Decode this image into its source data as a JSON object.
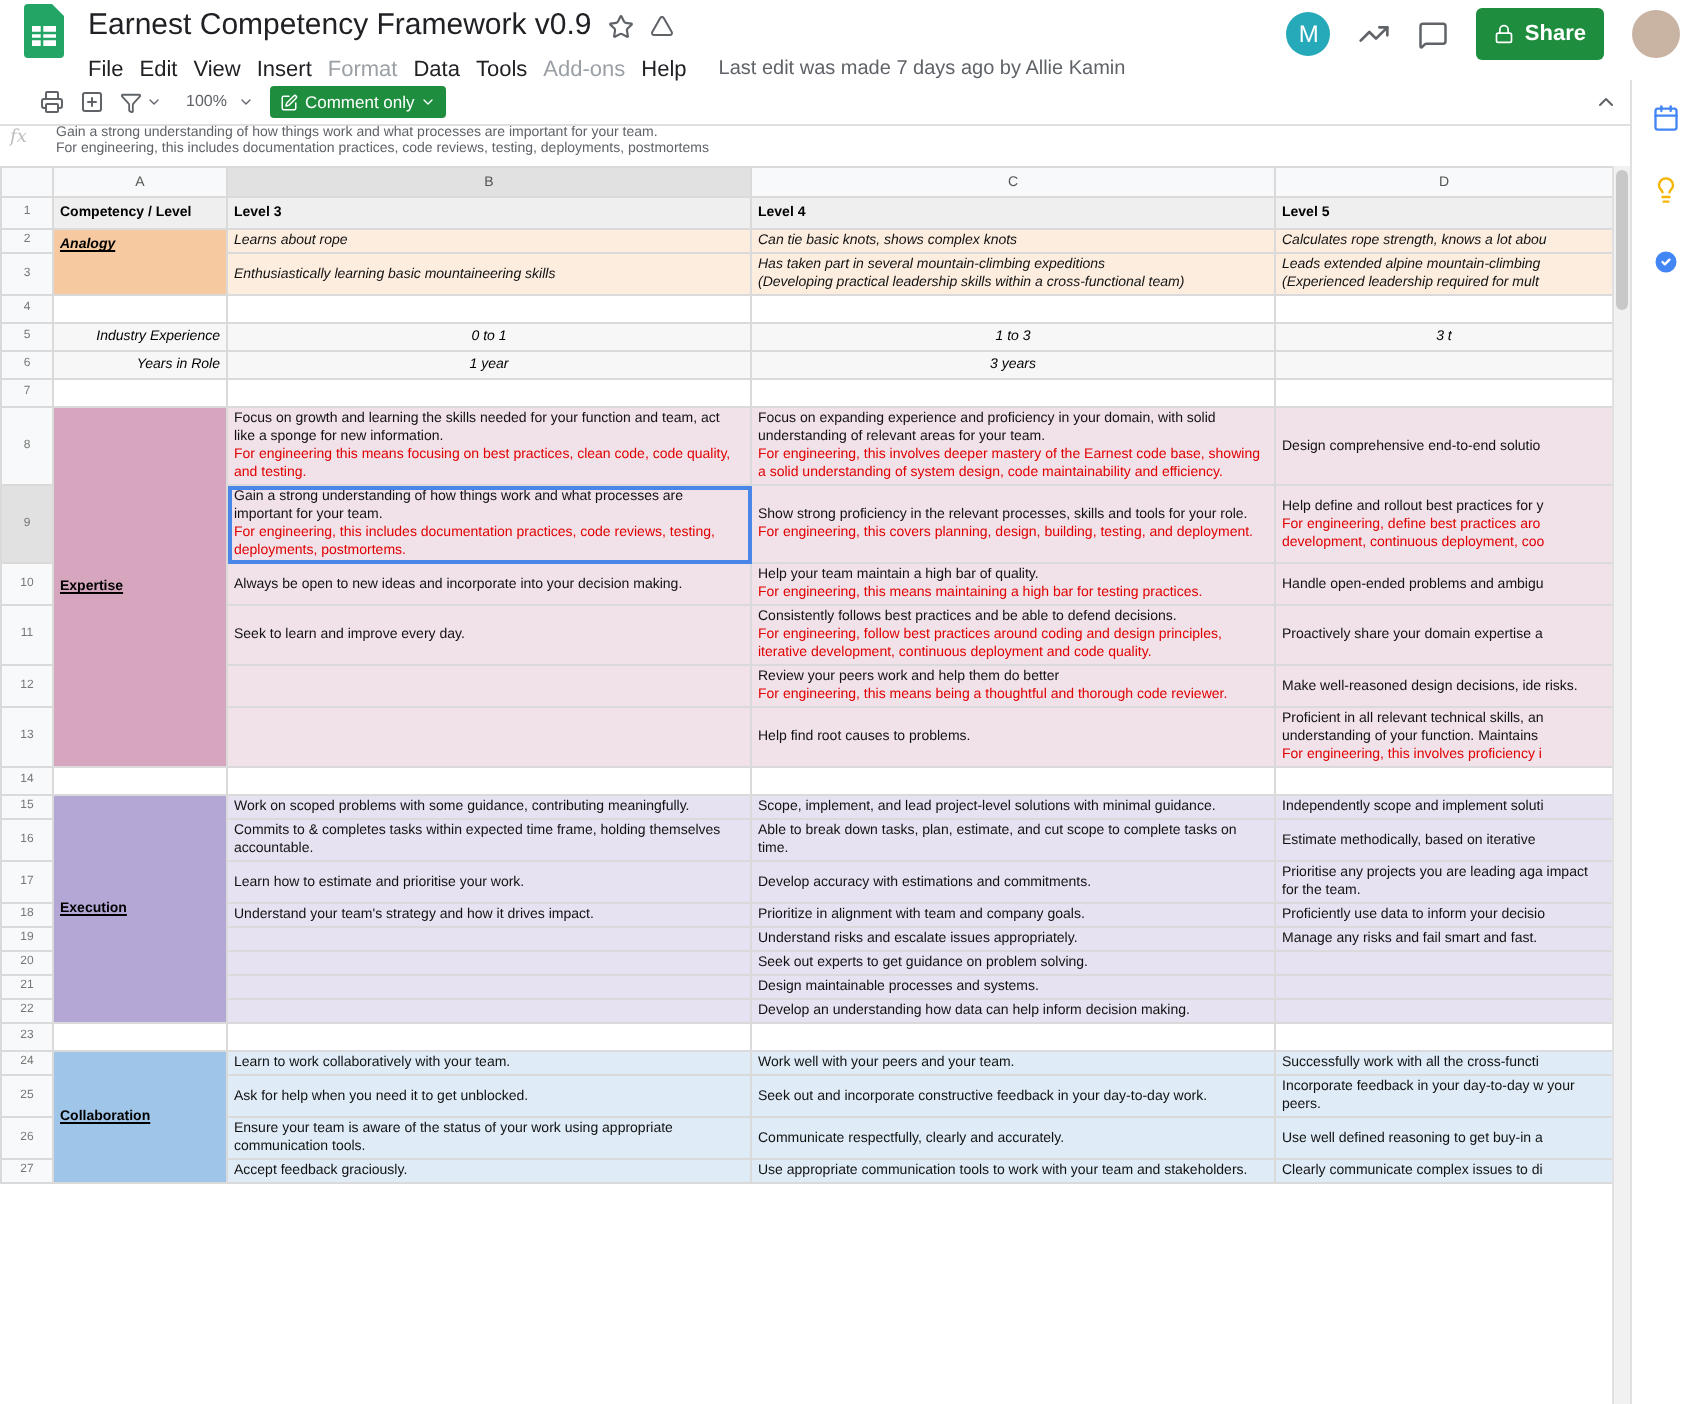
{
  "document": {
    "title": "Earnest Competency Framework v0.9",
    "starred": false,
    "last_edit": "Last edit was made 7 days ago by Allie Kamin"
  },
  "menu": [
    {
      "label": "File",
      "disabled": false
    },
    {
      "label": "Edit",
      "disabled": false
    },
    {
      "label": "View",
      "disabled": false
    },
    {
      "label": "Insert",
      "disabled": false
    },
    {
      "label": "Format",
      "disabled": true
    },
    {
      "label": "Data",
      "disabled": false
    },
    {
      "label": "Tools",
      "disabled": false
    },
    {
      "label": "Add-ons",
      "disabled": true
    },
    {
      "label": "Help",
      "disabled": false
    }
  ],
  "account": {
    "initial": "M"
  },
  "share": {
    "label": "Share"
  },
  "toolbar": {
    "zoom": "100%",
    "mode": "Comment only"
  },
  "formula_bar": {
    "label": "fx",
    "value": "Gain a strong understanding of how things work and what processes are important for your team.\nFor engineering, this includes documentation practices, code reviews, testing, deployments, postmortems"
  },
  "grid": {
    "columns": [
      {
        "label": "A",
        "selected": false
      },
      {
        "label": "B",
        "selected": true
      },
      {
        "label": "C",
        "selected": false
      },
      {
        "label": "D",
        "selected": false
      }
    ],
    "blocks": [
      {
        "kind": "header",
        "rows": [
          {
            "number": "1",
            "selected": false,
            "cells": [
              "Competency / Level",
              "Level 3",
              "Level 4",
              "Level 5"
            ]
          }
        ]
      },
      {
        "kind": "example",
        "label": "Analogy",
        "color": "#f6c9a0",
        "rows": [
          {
            "number": "2",
            "selected": false,
            "cells": [
              {
                "text": "Learns about rope"
              },
              {
                "text": "Can tie basic knots, shows complex knots"
              },
              {
                "text": "Calculates rope strength, knows a lot abou"
              }
            ]
          },
          {
            "number": "3",
            "selected": false,
            "cells": [
              {
                "text": "Enthusiastically learning basic mountaineering skills"
              },
              {
                "text": "Has taken part in several mountain-climbing expeditions\n(Developing practical leadership skills within a cross-functional team)"
              },
              {
                "text": "Leads extended alpine mountain-climbing\n(Experienced leadership required for mult"
              }
            ]
          }
        ]
      },
      {
        "kind": "spacer",
        "rows": [
          {
            "number": "4",
            "selected": false
          }
        ]
      },
      {
        "kind": "attribute",
        "rows": [
          {
            "number": "5",
            "selected": false,
            "label": "Industry Experience",
            "cells": [
              "0 to 1",
              "1 to 3",
              "3 t"
            ]
          },
          {
            "number": "6",
            "selected": false,
            "label": "Years in Role",
            "cells": [
              "1 year",
              "3 years"
            ]
          }
        ]
      },
      {
        "kind": "spacer",
        "rows": [
          {
            "number": "7",
            "selected": false
          }
        ]
      },
      {
        "kind": "competency",
        "label": "Expertise",
        "color": "#d5a6bd",
        "rows": [
          {
            "number": "8",
            "selected": false,
            "cells": [
              {
                "text": "Focus on growth and learning the skills needed for your function and team, act like a sponge for new information.",
                "note": "For engineering this means focusing on best practices, clean code, code quality, and testing."
              },
              {
                "text": "Focus on expanding experience and proficiency in your domain, with solid understanding of relevant areas for your team.",
                "note": "For engineering, this involves deeper mastery of the Earnest code base, showing a solid understanding of system design, code maintainability and efficiency."
              },
              {
                "text": "Design comprehensive end-to-end solutio"
              }
            ]
          },
          {
            "number": "9",
            "selected": true,
            "cells": [
              {
                "text": "Gain a strong understanding of how things work and what processes are important for your team.",
                "note": "For engineering, this includes documentation practices, code reviews, testing, deployments, postmortems."
              },
              {
                "text": "Show strong proficiency in the relevant processes, skills and tools for your role.",
                "note": "For engineering, this covers planning, design, building, testing, and deployment."
              },
              {
                "text": "Help define and rollout best practices for y",
                "note": "For engineering, define best practices aro development, continuous deployment, coo"
              }
            ]
          },
          {
            "number": "10",
            "selected": false,
            "cells": [
              {
                "text": "Always be open to new ideas and incorporate into your decision making."
              },
              {
                "text": "Help your team maintain a high bar of quality.",
                "note": "For engineering, this means maintaining a high bar for testing practices."
              },
              {
                "text": "Handle open-ended problems and ambigu"
              }
            ]
          },
          {
            "number": "11",
            "selected": false,
            "cells": [
              {
                "text": "Seek to learn and improve every day."
              },
              {
                "text": "Consistently follows best practices and be able to defend decisions.",
                "note": "For engineering, follow best practices around coding and design principles, iterative development, continuous deployment and code quality."
              },
              {
                "text": "Proactively share your domain expertise a"
              }
            ]
          },
          {
            "number": "12",
            "selected": false,
            "cells": [
              {},
              {
                "text": "Review your peers work and help them do better",
                "note": "For engineering, this means being a thoughtful and thorough code reviewer."
              },
              {
                "text": "Make well-reasoned design decisions, ide risks."
              }
            ]
          },
          {
            "number": "13",
            "selected": false,
            "cells": [
              {},
              {
                "text": "Help find root causes to problems."
              },
              {
                "text": "Proficient in all relevant technical skills, an understanding of your function. Maintains",
                "note": "For engineering, this involves proficiency i"
              }
            ]
          }
        ]
      },
      {
        "kind": "spacer",
        "rows": [
          {
            "number": "14",
            "selected": false
          }
        ]
      },
      {
        "kind": "competency",
        "label": "Execution",
        "color": "#b4a7d6",
        "rows": [
          {
            "number": "15",
            "selected": false,
            "cells": [
              {
                "text": "Work on scoped problems with some guidance, contributing meaningfully."
              },
              {
                "text": "Scope, implement, and lead project-level solutions with minimal guidance."
              },
              {
                "text": "Independently scope and implement soluti"
              }
            ]
          },
          {
            "number": "16",
            "selected": false,
            "cells": [
              {
                "text": "Commits to & completes tasks within expected time frame, holding themselves accountable."
              },
              {
                "text": "Able to break down tasks, plan, estimate, and cut scope to complete tasks on time."
              },
              {
                "text": "Estimate methodically, based on iterative"
              }
            ]
          },
          {
            "number": "17",
            "selected": false,
            "cells": [
              {
                "text": "Learn how to estimate and prioritise your work."
              },
              {
                "text": "Develop accuracy with estimations and commitments."
              },
              {
                "text": "Prioritise any projects you are leading aga impact for the team."
              }
            ]
          },
          {
            "number": "18",
            "selected": false,
            "cells": [
              {
                "text": "Understand your team's strategy and how it drives impact."
              },
              {
                "text": "Prioritize in alignment with team and company goals."
              },
              {
                "text": "Proficiently use data to inform your decisio"
              }
            ]
          },
          {
            "number": "19",
            "selected": false,
            "cells": [
              {},
              {
                "text": "Understand risks and escalate issues appropriately."
              },
              {
                "text": "Manage any risks and fail smart and fast."
              }
            ]
          },
          {
            "number": "20",
            "selected": false,
            "cells": [
              {},
              {
                "text": "Seek out experts to get guidance on problem solving."
              },
              {}
            ]
          },
          {
            "number": "21",
            "selected": false,
            "cells": [
              {},
              {
                "text": "Design maintainable processes and systems."
              },
              {}
            ]
          },
          {
            "number": "22",
            "selected": false,
            "cells": [
              {},
              {
                "text": "Develop an understanding how data can help inform decision making."
              },
              {}
            ]
          }
        ]
      },
      {
        "kind": "spacer",
        "rows": [
          {
            "number": "23",
            "selected": false
          }
        ]
      },
      {
        "kind": "competency",
        "label": "Collaboration",
        "color": "#9fc5e8",
        "rows": [
          {
            "number": "24",
            "selected": false,
            "cells": [
              {
                "text": "Learn to work collaboratively with your team."
              },
              {
                "text": "Work well with your peers and your team."
              },
              {
                "text": "Successfully work with all the cross-functi"
              }
            ]
          },
          {
            "number": "25",
            "selected": false,
            "cells": [
              {
                "text": "Ask for help when you need it to get unblocked."
              },
              {
                "text": "Seek out and incorporate constructive feedback in your day-to-day work."
              },
              {
                "text": "Incorporate feedback in your day-to-day w your peers."
              }
            ]
          },
          {
            "number": "26",
            "selected": false,
            "cells": [
              {
                "text": "Ensure your team is aware of the status of your work using appropriate communication tools."
              },
              {
                "text": "Communicate respectfully, clearly and accurately."
              },
              {
                "text": "Use well defined reasoning to get buy-in a"
              }
            ]
          },
          {
            "number": "27",
            "selected": false,
            "cells": [
              {
                "text": "Accept feedback graciously."
              },
              {
                "text": "Use appropriate communication tools to work with your team and stakeholders."
              },
              {
                "text": "Clearly communicate complex issues to di"
              }
            ]
          }
        ]
      }
    ]
  }
}
